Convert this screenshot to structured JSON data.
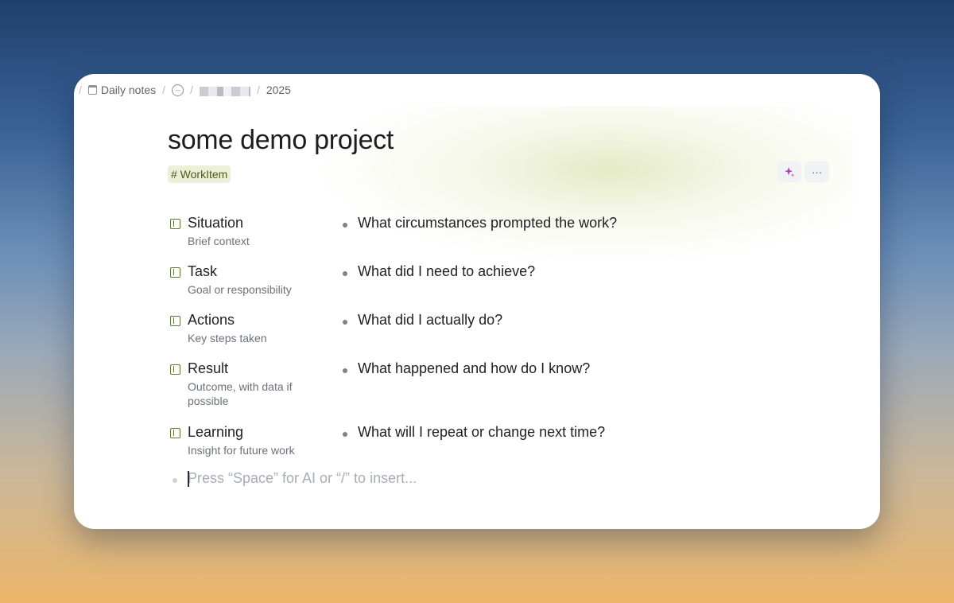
{
  "breadcrumb": {
    "items": [
      {
        "label": "Daily notes",
        "icon": "calendar-icon"
      },
      {
        "label": "",
        "icon": "more-dots-icon"
      },
      {
        "label": "",
        "icon": "redacted-block"
      },
      {
        "label": "2025",
        "icon": ""
      }
    ],
    "separator": "/"
  },
  "page": {
    "title": "some demo project",
    "tag": "# WorkItem",
    "ai_button_icon": "sparkle-icon",
    "more_button_label": "···"
  },
  "rows": [
    {
      "label": "Situation",
      "description": "Brief context",
      "prompt": "What circumstances prompted the work?"
    },
    {
      "label": "Task",
      "description": "Goal or responsibility",
      "prompt": "What did I need to achieve?"
    },
    {
      "label": "Actions",
      "description": "Key steps taken",
      "prompt": "What did I actually do?"
    },
    {
      "label": "Result",
      "description": "Outcome, with data if possible",
      "prompt": "What happened and how do I know?"
    },
    {
      "label": "Learning",
      "description": "Insight for future work",
      "prompt": "What will I repeat or change next time?"
    }
  ],
  "editor": {
    "placeholder": "Press “Space” for AI or “/” to insert..."
  },
  "colors": {
    "tag_bg": "#edf0d8",
    "tag_text": "#4a5a1c",
    "ai_accent": "#b03ab8",
    "row_icon": "#5b7a3a"
  }
}
